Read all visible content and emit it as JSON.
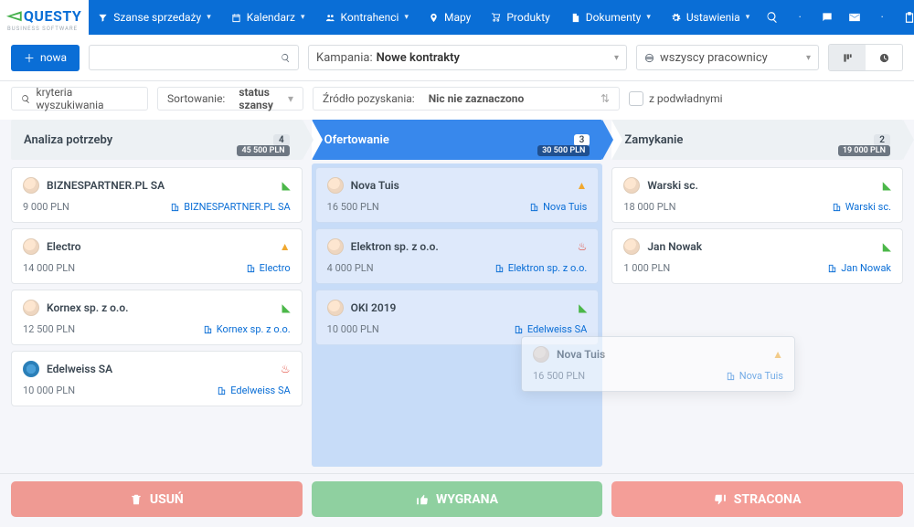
{
  "app": {
    "logo_main": "QUESTY",
    "logo_sub": "BUSINESS SOFTWARE"
  },
  "nav": {
    "items": [
      {
        "label": "Szanse sprzedaży",
        "icon": "funnel"
      },
      {
        "label": "Kalendarz",
        "icon": "calendar"
      },
      {
        "label": "Kontrahenci",
        "icon": "users"
      },
      {
        "label": "Mapy",
        "icon": "pin",
        "nodrop": true
      },
      {
        "label": "Produkty",
        "icon": "cart",
        "nodrop": true
      },
      {
        "label": "Dokumenty",
        "icon": "doc"
      },
      {
        "label": "Ustawienia",
        "icon": "gear"
      }
    ]
  },
  "filters": {
    "new_button": "nowa",
    "campaign_label": "Kampania:",
    "campaign_value": "Nowe kontrakty",
    "employees_value": "wszyscy pracownicy",
    "criteria_label": "kryteria wyszukiwania",
    "sort_label": "Sortowanie:",
    "sort_value": "status szansy",
    "source_label": "Źródło pozyskania:",
    "source_value": "Nic nie zaznaczono",
    "subordinates_label": "z podwładnymi"
  },
  "columns": [
    {
      "title": "Analiza potrzeby",
      "count": "4",
      "sum": "45 500 PLN",
      "active": false,
      "cards": [
        {
          "title": "BIZNESPARTNER.PL SA",
          "value": "9 000 PLN",
          "company": "BIZNESPARTNER.PL SA",
          "state": "ok",
          "avatar": "p"
        },
        {
          "title": "Electro",
          "value": "14 000 PLN",
          "company": "Electro",
          "state": "warn",
          "avatar": "p"
        },
        {
          "title": "Kornex sp. z o.o.",
          "value": "12 500 PLN",
          "company": "Kornex sp. z o.o.",
          "state": "ok",
          "avatar": "p"
        },
        {
          "title": "Edelweiss SA",
          "value": "10 000 PLN",
          "company": "Edelweiss SA",
          "state": "hot",
          "avatar": "c"
        }
      ]
    },
    {
      "title": "Ofertowanie",
      "count": "3",
      "sum": "30 500 PLN",
      "active": true,
      "cards": [
        {
          "title": "Nova Tuis",
          "value": "16 500 PLN",
          "company": "Nova Tuis",
          "state": "warn",
          "avatar": "p"
        },
        {
          "title": "Elektron sp. z o.o.",
          "value": "4 000 PLN",
          "company": "Elektron sp. z o.o.",
          "state": "hot",
          "avatar": "p"
        },
        {
          "title": "OKI 2019",
          "value": "10 000 PLN",
          "company": "Edelweiss SA",
          "state": "ok",
          "avatar": "p"
        }
      ]
    },
    {
      "title": "Zamykanie",
      "count": "2",
      "sum": "19 000 PLN",
      "active": false,
      "cards": [
        {
          "title": "Warski sc.",
          "value": "18 000 PLN",
          "company": "Warski sc.",
          "state": "ok",
          "avatar": "p"
        },
        {
          "title": "Jan Nowak",
          "value": "1 000 PLN",
          "company": "Jan Nowak",
          "state": "ok",
          "avatar": "p"
        }
      ]
    }
  ],
  "ghost": {
    "title": "Nova Tuis",
    "value": "16 500 PLN",
    "company": "Nova Tuis"
  },
  "actions": {
    "delete": "USUŃ",
    "win": "WYGRANA",
    "lose": "STRACONA"
  }
}
